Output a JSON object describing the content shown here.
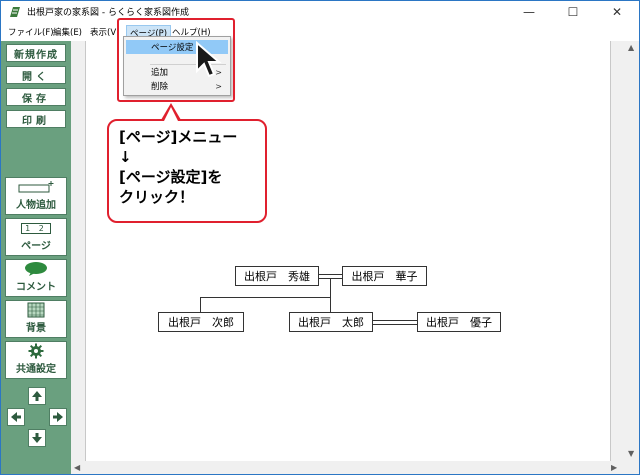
{
  "window": {
    "title": "出根戸家の家系図 - らくらく家系図作成",
    "minimize": "—",
    "maximize": "☐",
    "close": "✕"
  },
  "menu": {
    "file": "ファイル(F)",
    "edit": "編集(E)",
    "view": "表示(V",
    "page": "ページ(P)",
    "help": "ヘルプ(H)"
  },
  "page_menu": {
    "items": [
      "ページ設定",
      "追加",
      "削除"
    ],
    "submenu_arrow": ">"
  },
  "toolbar": {
    "new": "新規作成",
    "open": "開く",
    "save": "保存",
    "print": "印刷",
    "add_person": "人物追加",
    "page": "ページ",
    "page_icon_text": "1 2",
    "comment": "コメント",
    "background": "背景",
    "common_settings": "共通設定"
  },
  "tree": {
    "hideo": "出根戸　秀雄",
    "hanako": "出根戸　華子",
    "jiro": "出根戸　次郎",
    "taro": "出根戸　太郎",
    "yuko": "出根戸　優子"
  },
  "callout": {
    "line1": "[ページ]メニュー",
    "line2": "↓",
    "line3": "[ページ設定]を",
    "line4": "クリック！"
  },
  "colors": {
    "toolbar_bg": "#6aa07f",
    "highlight_red": "#e0202e",
    "menu_highlight": "#91c9f7"
  },
  "icons": [
    "app-icon",
    "zoom-in-icon",
    "zoom-out-icon",
    "add-person-icon",
    "page-icon",
    "comment-icon",
    "background-icon",
    "gear-icon",
    "arrow-up-icon",
    "arrow-left-icon",
    "arrow-right-icon",
    "arrow-down-icon",
    "cursor-icon"
  ]
}
